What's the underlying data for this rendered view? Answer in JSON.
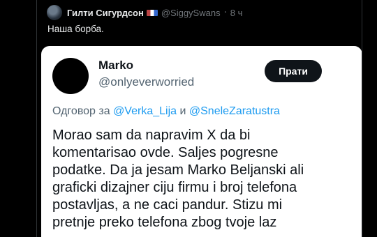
{
  "post": {
    "author_name": "Гилти Сигурдсон",
    "author_handle": "@SiggySwans",
    "time": "8 ч",
    "text": "Наша борба."
  },
  "embed": {
    "name": "Marko",
    "handle": "@onlyeverworried",
    "follow_label": "Прати",
    "reply_prefix": "Одговор за",
    "reply_mention_1": "@Verka_Lija",
    "reply_conj": "и",
    "reply_mention_2": "@SneleZaratustra",
    "body_lines": [
      "Morao sam da napravim X da bi",
      "komentarisao ovde. Saljes pogresne",
      "podatke. Da ja jesam Marko Beljanski ali",
      "graficki dizajner ciju firmu i broj telefona",
      "postavljas, a ne caci pandur. Stizu mi",
      "pretnje preko telefona zbog tvoje laz"
    ]
  },
  "colors": {
    "background": "#000000",
    "card": "#ffffff",
    "mention": "#1d9bf0",
    "follow_button": "#0f1419"
  }
}
